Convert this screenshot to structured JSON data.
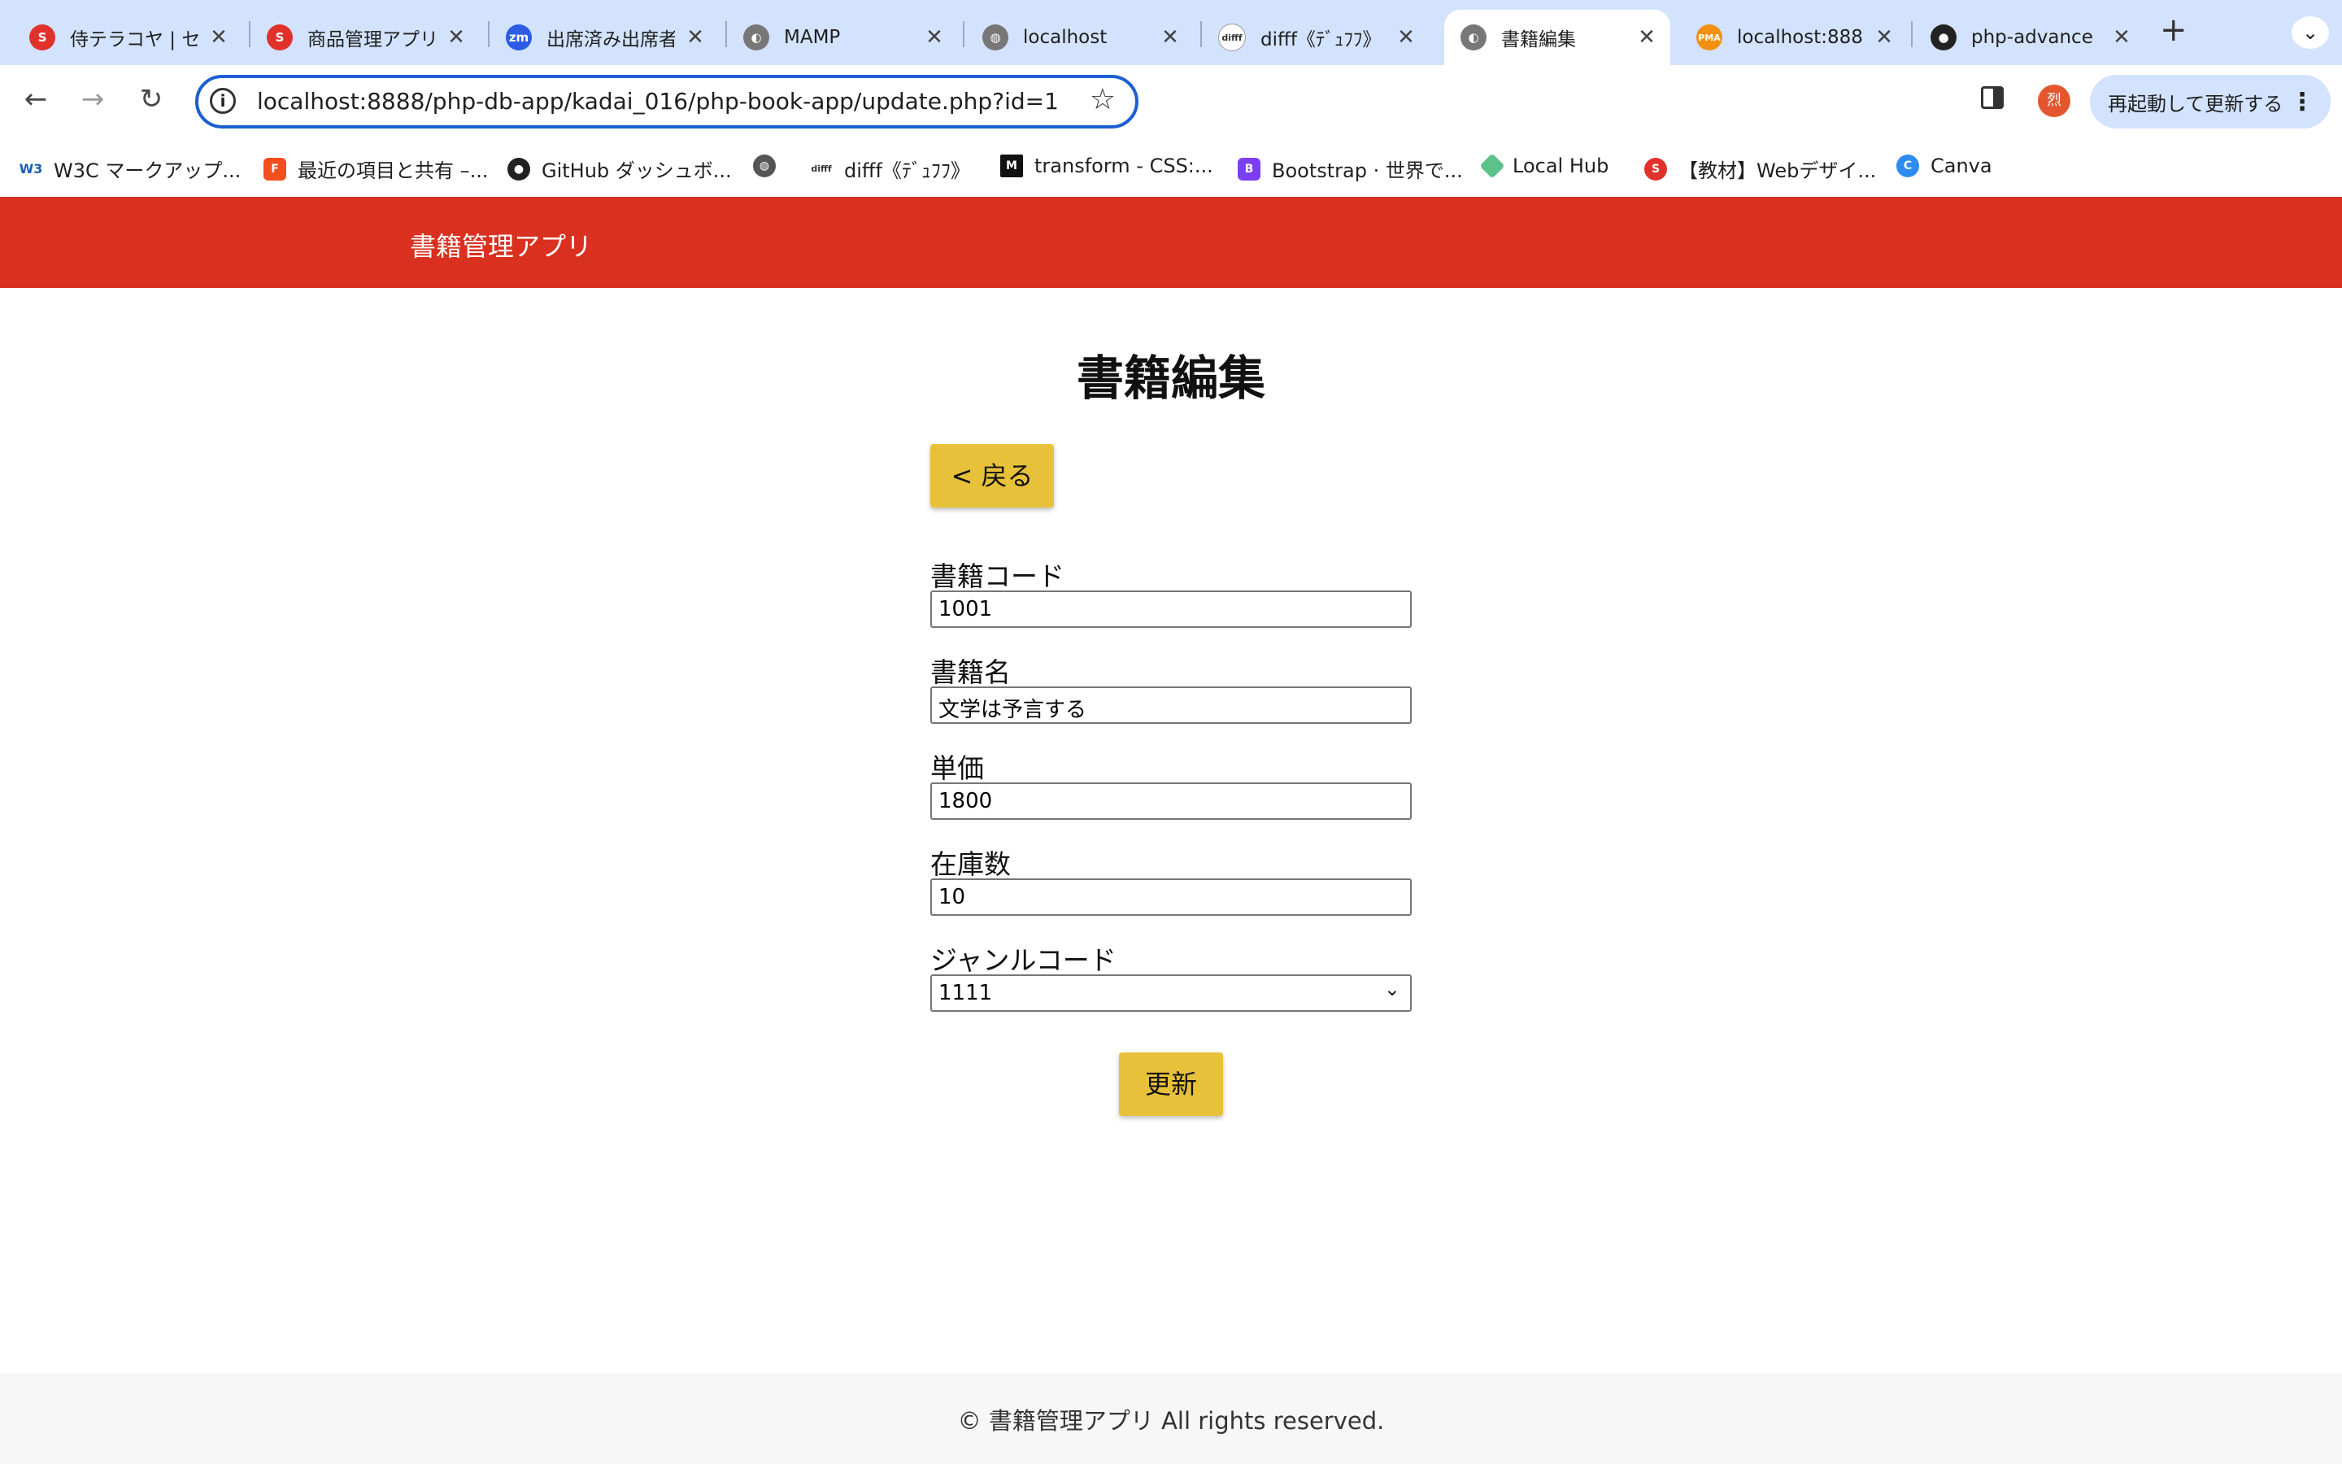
{
  "browser": {
    "tabs": [
      {
        "title": "侍テラコヤ | セ",
        "icon": "samurai-icon",
        "color": "#e0322b"
      },
      {
        "title": "商品管理アプリ",
        "icon": "samurai-icon",
        "color": "#e0322b"
      },
      {
        "title": "出席済み出席者",
        "icon": "zm-icon",
        "color": "#2d5be3"
      },
      {
        "title": "MAMP",
        "icon": "mamp-icon",
        "color": "#777777"
      },
      {
        "title": "localhost",
        "icon": "globe-icon",
        "color": "#777777"
      },
      {
        "title": "difff《ﾃﾞｭﾌﾌ》",
        "icon": "difff-icon",
        "color": "#333333"
      },
      {
        "title": "書籍編集",
        "icon": "mamp-icon",
        "color": "#777777"
      },
      {
        "title": "localhost:888",
        "icon": "pma-icon",
        "color": "#f29111"
      },
      {
        "title": "php-advance",
        "icon": "github-icon",
        "color": "#222222"
      }
    ],
    "new_tab": "+",
    "url": "localhost:8888/php-db-app/kadai_016/php-book-app/update.php?id=1",
    "avatar_text": "烈",
    "update_button": "再起動して更新する",
    "bookmarks": [
      {
        "label": "W3C マークアップ...",
        "icon": "w3c-icon"
      },
      {
        "label": "最近の項目と共有 –...",
        "icon": "figma-icon"
      },
      {
        "label": "GitHub ダッシュボ...",
        "icon": "github-icon"
      },
      {
        "label": "",
        "icon": "globe-icon"
      },
      {
        "label": "difff《ﾃﾞｭﾌﾌ》",
        "icon": "difff-icon"
      },
      {
        "label": "transform - CSS:...",
        "icon": "mdn-icon"
      },
      {
        "label": "Bootstrap · 世界で...",
        "icon": "bootstrap-icon"
      },
      {
        "label": "Local Hub",
        "icon": "localhub-icon"
      },
      {
        "label": "【教材】Webデザイ...",
        "icon": "samurai-icon"
      },
      {
        "label": "Canva",
        "icon": "canva-icon"
      }
    ]
  },
  "page": {
    "app_name": "書籍管理アプリ",
    "title": "書籍編集",
    "back_button": "< 戻る",
    "fields": {
      "book_code": {
        "label": "書籍コード",
        "value": "1001"
      },
      "book_name": {
        "label": "書籍名",
        "value": "文学は予言する"
      },
      "price": {
        "label": "単価",
        "value": "1800"
      },
      "stock": {
        "label": "在庫数",
        "value": "10"
      },
      "genre_code": {
        "label": "ジャンルコード",
        "value": "1111"
      }
    },
    "submit_button": "更新",
    "footer": "© 書籍管理アプリ All rights reserved.",
    "colors": {
      "header": "#d9301f",
      "button": "#e8c13a"
    }
  }
}
